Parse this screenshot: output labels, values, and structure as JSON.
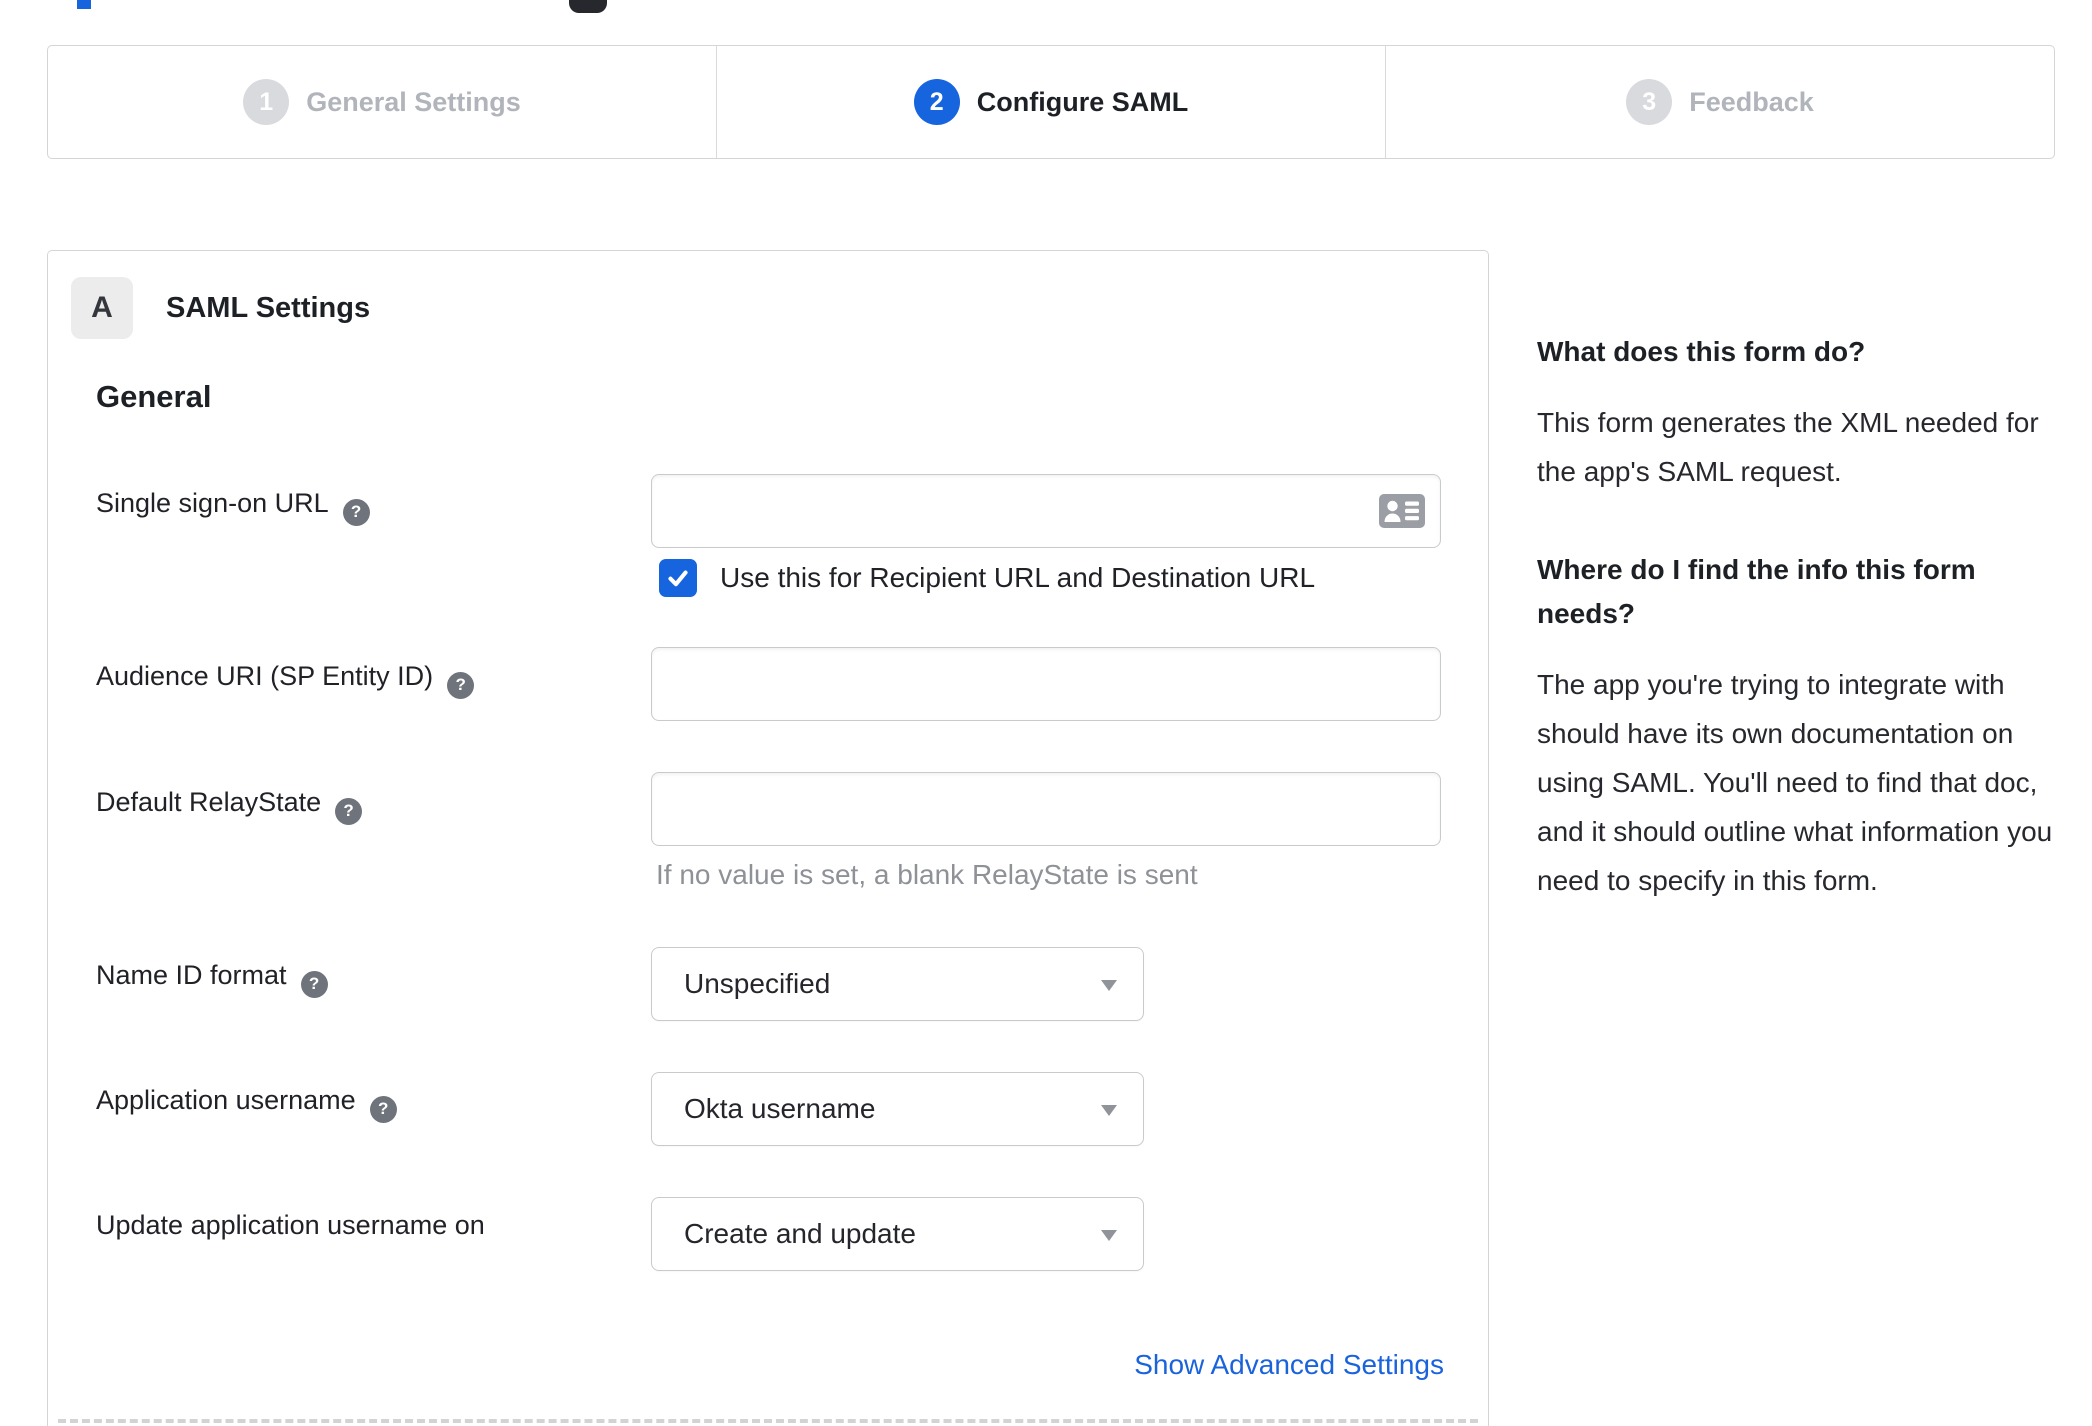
{
  "colors": {
    "accent_blue": "#1664de",
    "link_blue": "#1b63dc",
    "checkbox_blue": "#1664de",
    "step_inactive_circle": "#d8dade",
    "step_inactive_text": "#b1b4ba",
    "text_dark": "#1d2025",
    "panel_border": "#d5d5d5",
    "input_border": "#c9cacc",
    "hint_gray": "#8e9196",
    "help_icon_bg": "#6f737b",
    "card_icon_gray": "#9b9fa5"
  },
  "stepper": {
    "steps": [
      {
        "number": "1",
        "label": "General Settings",
        "state": "inactive"
      },
      {
        "number": "2",
        "label": "Configure SAML",
        "state": "active"
      },
      {
        "number": "3",
        "label": "Feedback",
        "state": "inactive"
      }
    ]
  },
  "panel": {
    "badge": "A",
    "title": "SAML Settings",
    "group_heading": "General",
    "fields": {
      "sso": {
        "label": "Single sign-on URL",
        "value": "",
        "has_help": true,
        "checkbox": {
          "label": "Use this for Recipient URL and Destination URL",
          "checked": true
        }
      },
      "audience": {
        "label": "Audience URI (SP Entity ID)",
        "value": "",
        "has_help": true
      },
      "relaystate": {
        "label": "Default RelayState",
        "value": "",
        "has_help": true,
        "hint": "If no value is set, a blank RelayState is sent"
      },
      "name_id_format": {
        "label": "Name ID format",
        "selected": "Unspecified",
        "has_help": true
      },
      "application_username": {
        "label": "Application username",
        "selected": "Okta username",
        "has_help": true
      },
      "update_application_username": {
        "label": "Update application username on",
        "selected": "Create and update",
        "has_help": false
      }
    },
    "advanced_settings_link": "Show Advanced Settings"
  },
  "sidebar": {
    "sections": [
      {
        "heading": "What does this form do?",
        "body": "This form generates the XML needed for the app's SAML request."
      },
      {
        "heading": "Where do I find the info this form needs?",
        "body": "The app you're trying to integrate with should have its own documentation on using SAML. You'll need to find that doc, and it should outline what information you need to specify in this form."
      }
    ]
  },
  "icons": {
    "help_glyph": "?"
  }
}
